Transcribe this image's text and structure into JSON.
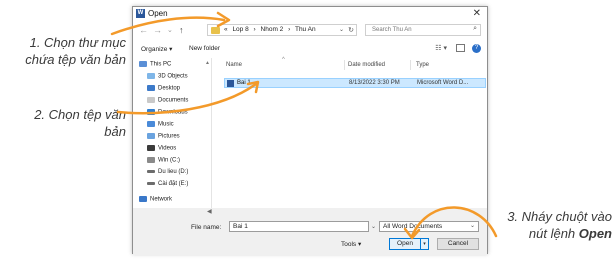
{
  "annotations": {
    "step1_line1": "1. Chọn thư mục",
    "step1_line2": "chứa tệp văn bản",
    "step2_line1": "2. Chọn tệp văn",
    "step2_line2": "bản",
    "step3_line1": "3. Nháy chuột vào",
    "step3_line2_prefix": "nút lệnh ",
    "step3_line2_bold": "Open"
  },
  "dialog": {
    "title": "Open",
    "app_icon_letter": "W",
    "close_glyph": "✕",
    "address": {
      "crumbs": [
        "«",
        "Lop 8",
        "›",
        "Nhom 2",
        "›",
        "Thu An"
      ],
      "dropdown_glyph": "⌄",
      "refresh_glyph": "↻"
    },
    "search": {
      "placeholder": "Search Thu An",
      "icon_glyph": "⌕"
    },
    "toolbar": {
      "organize": "Organize ▾",
      "new_folder": "New folder",
      "views_glyph": "☷ ▾",
      "help_glyph": "?"
    },
    "nav": {
      "items": [
        {
          "label": "This PC",
          "icon": "pc-icon"
        },
        {
          "label": "3D Objects",
          "icon": "cube-icon"
        },
        {
          "label": "Desktop",
          "icon": "desktop-icon"
        },
        {
          "label": "Documents",
          "icon": "documents-icon"
        },
        {
          "label": "Downloads",
          "icon": "download-icon"
        },
        {
          "label": "Music",
          "icon": "music-icon"
        },
        {
          "label": "Pictures",
          "icon": "pictures-icon"
        },
        {
          "label": "Videos",
          "icon": "videos-icon"
        },
        {
          "label": "Win (C:)",
          "icon": "drive-icon"
        },
        {
          "label": "Du lieu (D:)",
          "icon": "drive-icon"
        },
        {
          "label": "Cài đặt (E:)",
          "icon": "drive-icon"
        },
        {
          "label": "Network",
          "icon": "network-icon"
        }
      ]
    },
    "columns": {
      "name": "Name",
      "date": "Date modified",
      "type": "Type"
    },
    "files": [
      {
        "name": "Bai 1",
        "date": "8/13/2022 3:30 PM",
        "type": "Microsoft Word D..."
      }
    ],
    "bottom": {
      "file_name_label": "File name:",
      "file_name_value": "Bai 1",
      "file_type": "All Word Documents",
      "tools": "Tools ▾",
      "open": "Open",
      "split_glyph": "▾",
      "cancel": "Cancel"
    }
  },
  "colors": {
    "accent": "#0078d7",
    "arrow": "#f39a2a",
    "selection": "#cce8ff"
  }
}
